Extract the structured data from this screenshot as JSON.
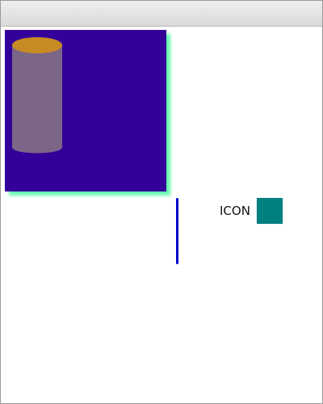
{
  "window": {
    "title": ""
  },
  "canvas_panel": {
    "background_color": "#330099",
    "shadow_color": "#66f6b0",
    "shape": {
      "type": "cylinder",
      "top_color": "#c88a23",
      "side_color": "#7c6687"
    }
  },
  "divider": {
    "color": "#0000cc"
  },
  "icon_group": {
    "label": "ICON",
    "icon_name": "square-icon",
    "icon_color": "#008080"
  }
}
